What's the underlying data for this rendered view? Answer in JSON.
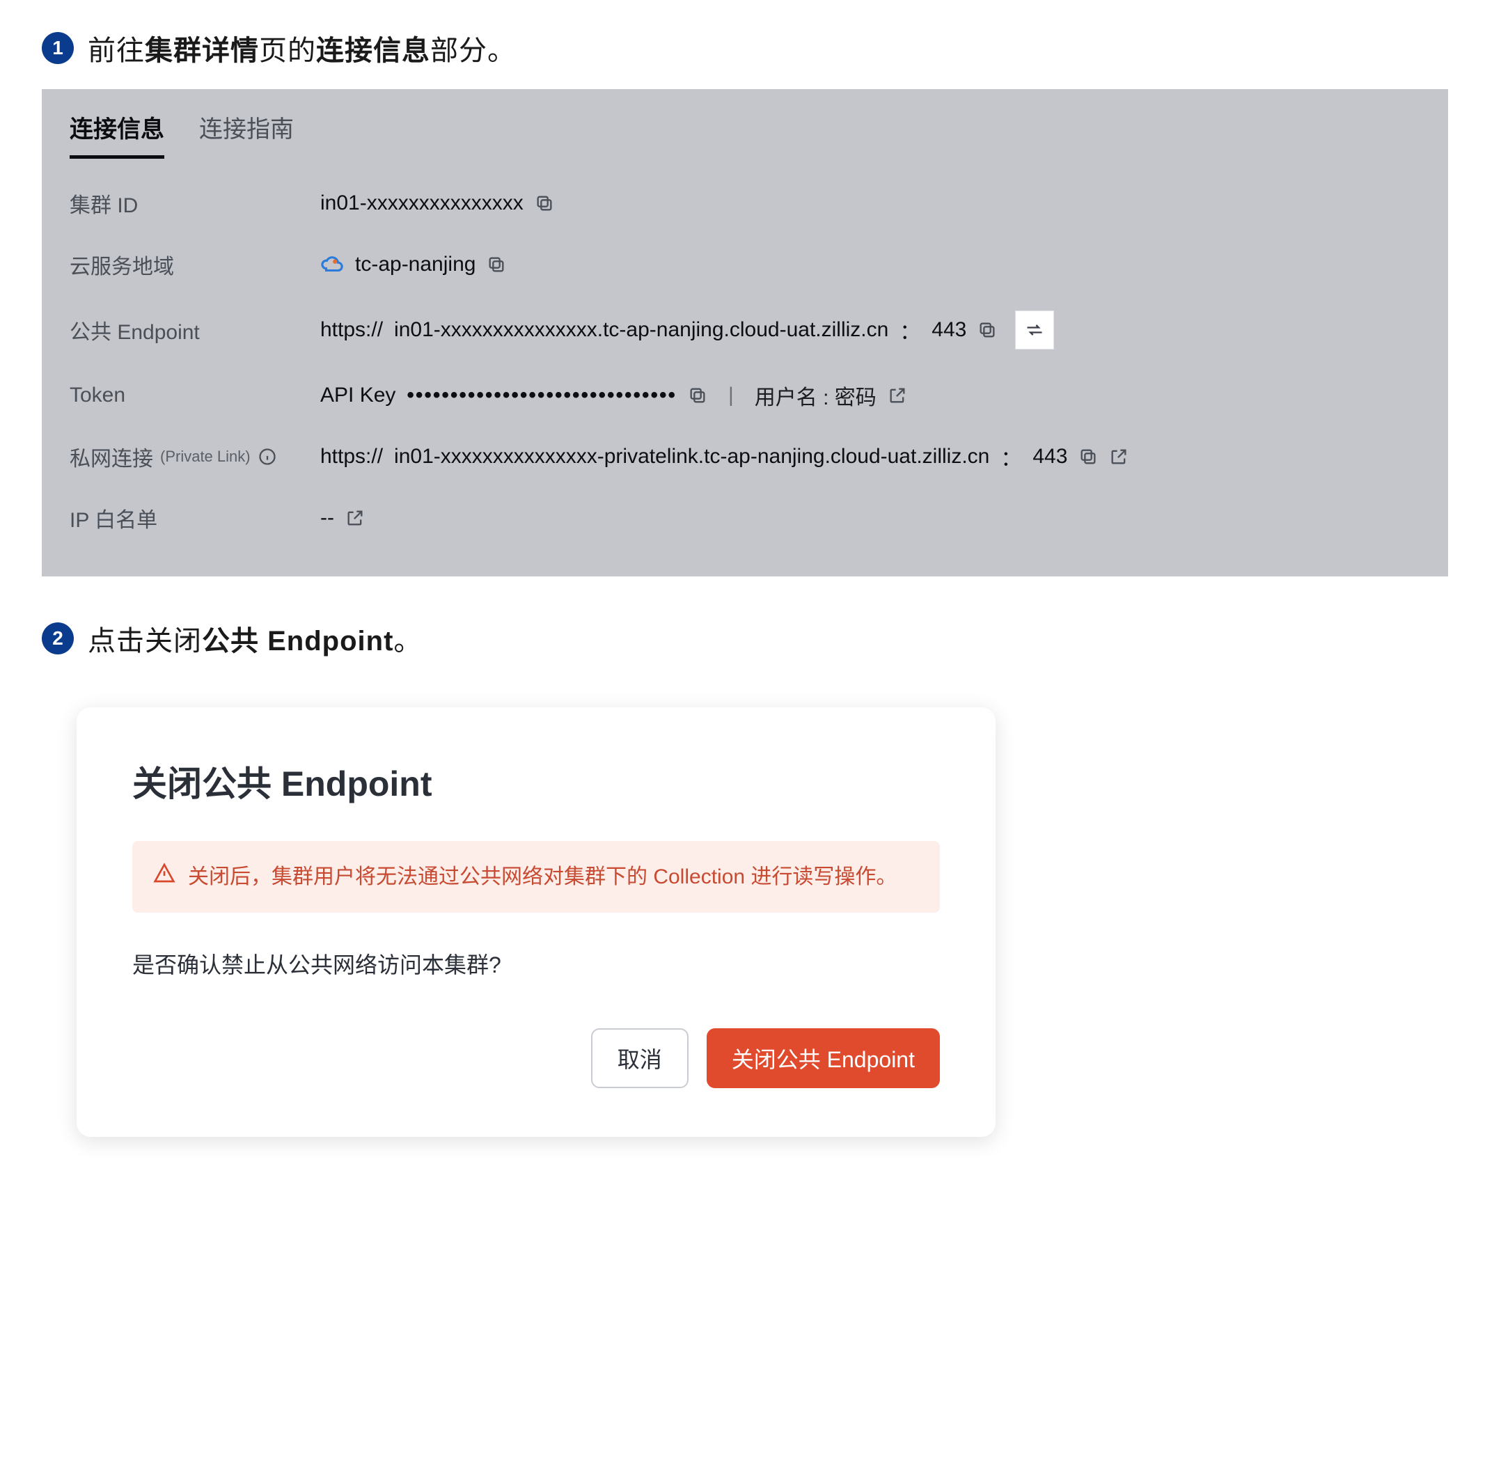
{
  "step1": {
    "number": "1",
    "text_prefix": "前往",
    "text_bold1": "集群详情",
    "text_mid": "页的",
    "text_bold2": "连接信息",
    "text_suffix": "部分。"
  },
  "panel": {
    "tabs": {
      "active": "连接信息",
      "inactive": "连接指南"
    },
    "rows": {
      "cluster_id": {
        "label": "集群 ID",
        "value": "in01-xxxxxxxxxxxxxxx"
      },
      "region": {
        "label": "云服务地域",
        "value": "tc-ap-nanjing"
      },
      "public_endpoint": {
        "label": "公共 Endpoint",
        "protocol": "https://",
        "host": "in01-xxxxxxxxxxxxxxx.tc-ap-nanjing.cloud-uat.zilliz.cn",
        "colon": "：",
        "port": "443"
      },
      "token": {
        "label": "Token",
        "api_key_label": "API Key",
        "masked": "•••••••••••••••••••••••••••••••",
        "user_pass": "用户名 : 密码"
      },
      "private_link": {
        "label": "私网连接",
        "label_sub": "(Private Link)",
        "protocol": "https://",
        "host": "in01-xxxxxxxxxxxxxxx-privatelink.tc-ap-nanjing.cloud-uat.zilliz.cn",
        "colon": "：",
        "port": "443"
      },
      "ip_whitelist": {
        "label": "IP 白名单",
        "value": "--"
      }
    }
  },
  "step2": {
    "number": "2",
    "text_prefix": "点击关闭",
    "text_bold": "公共 Endpoint",
    "text_suffix": "。"
  },
  "dialog": {
    "title": "关闭公共 Endpoint",
    "alert": "关闭后，集群用户将无法通过公共网络对集群下的 Collection 进行读写操作。",
    "body": "是否确认禁止从公共网络访问本集群?",
    "cancel": "取消",
    "confirm": "关闭公共 Endpoint"
  }
}
